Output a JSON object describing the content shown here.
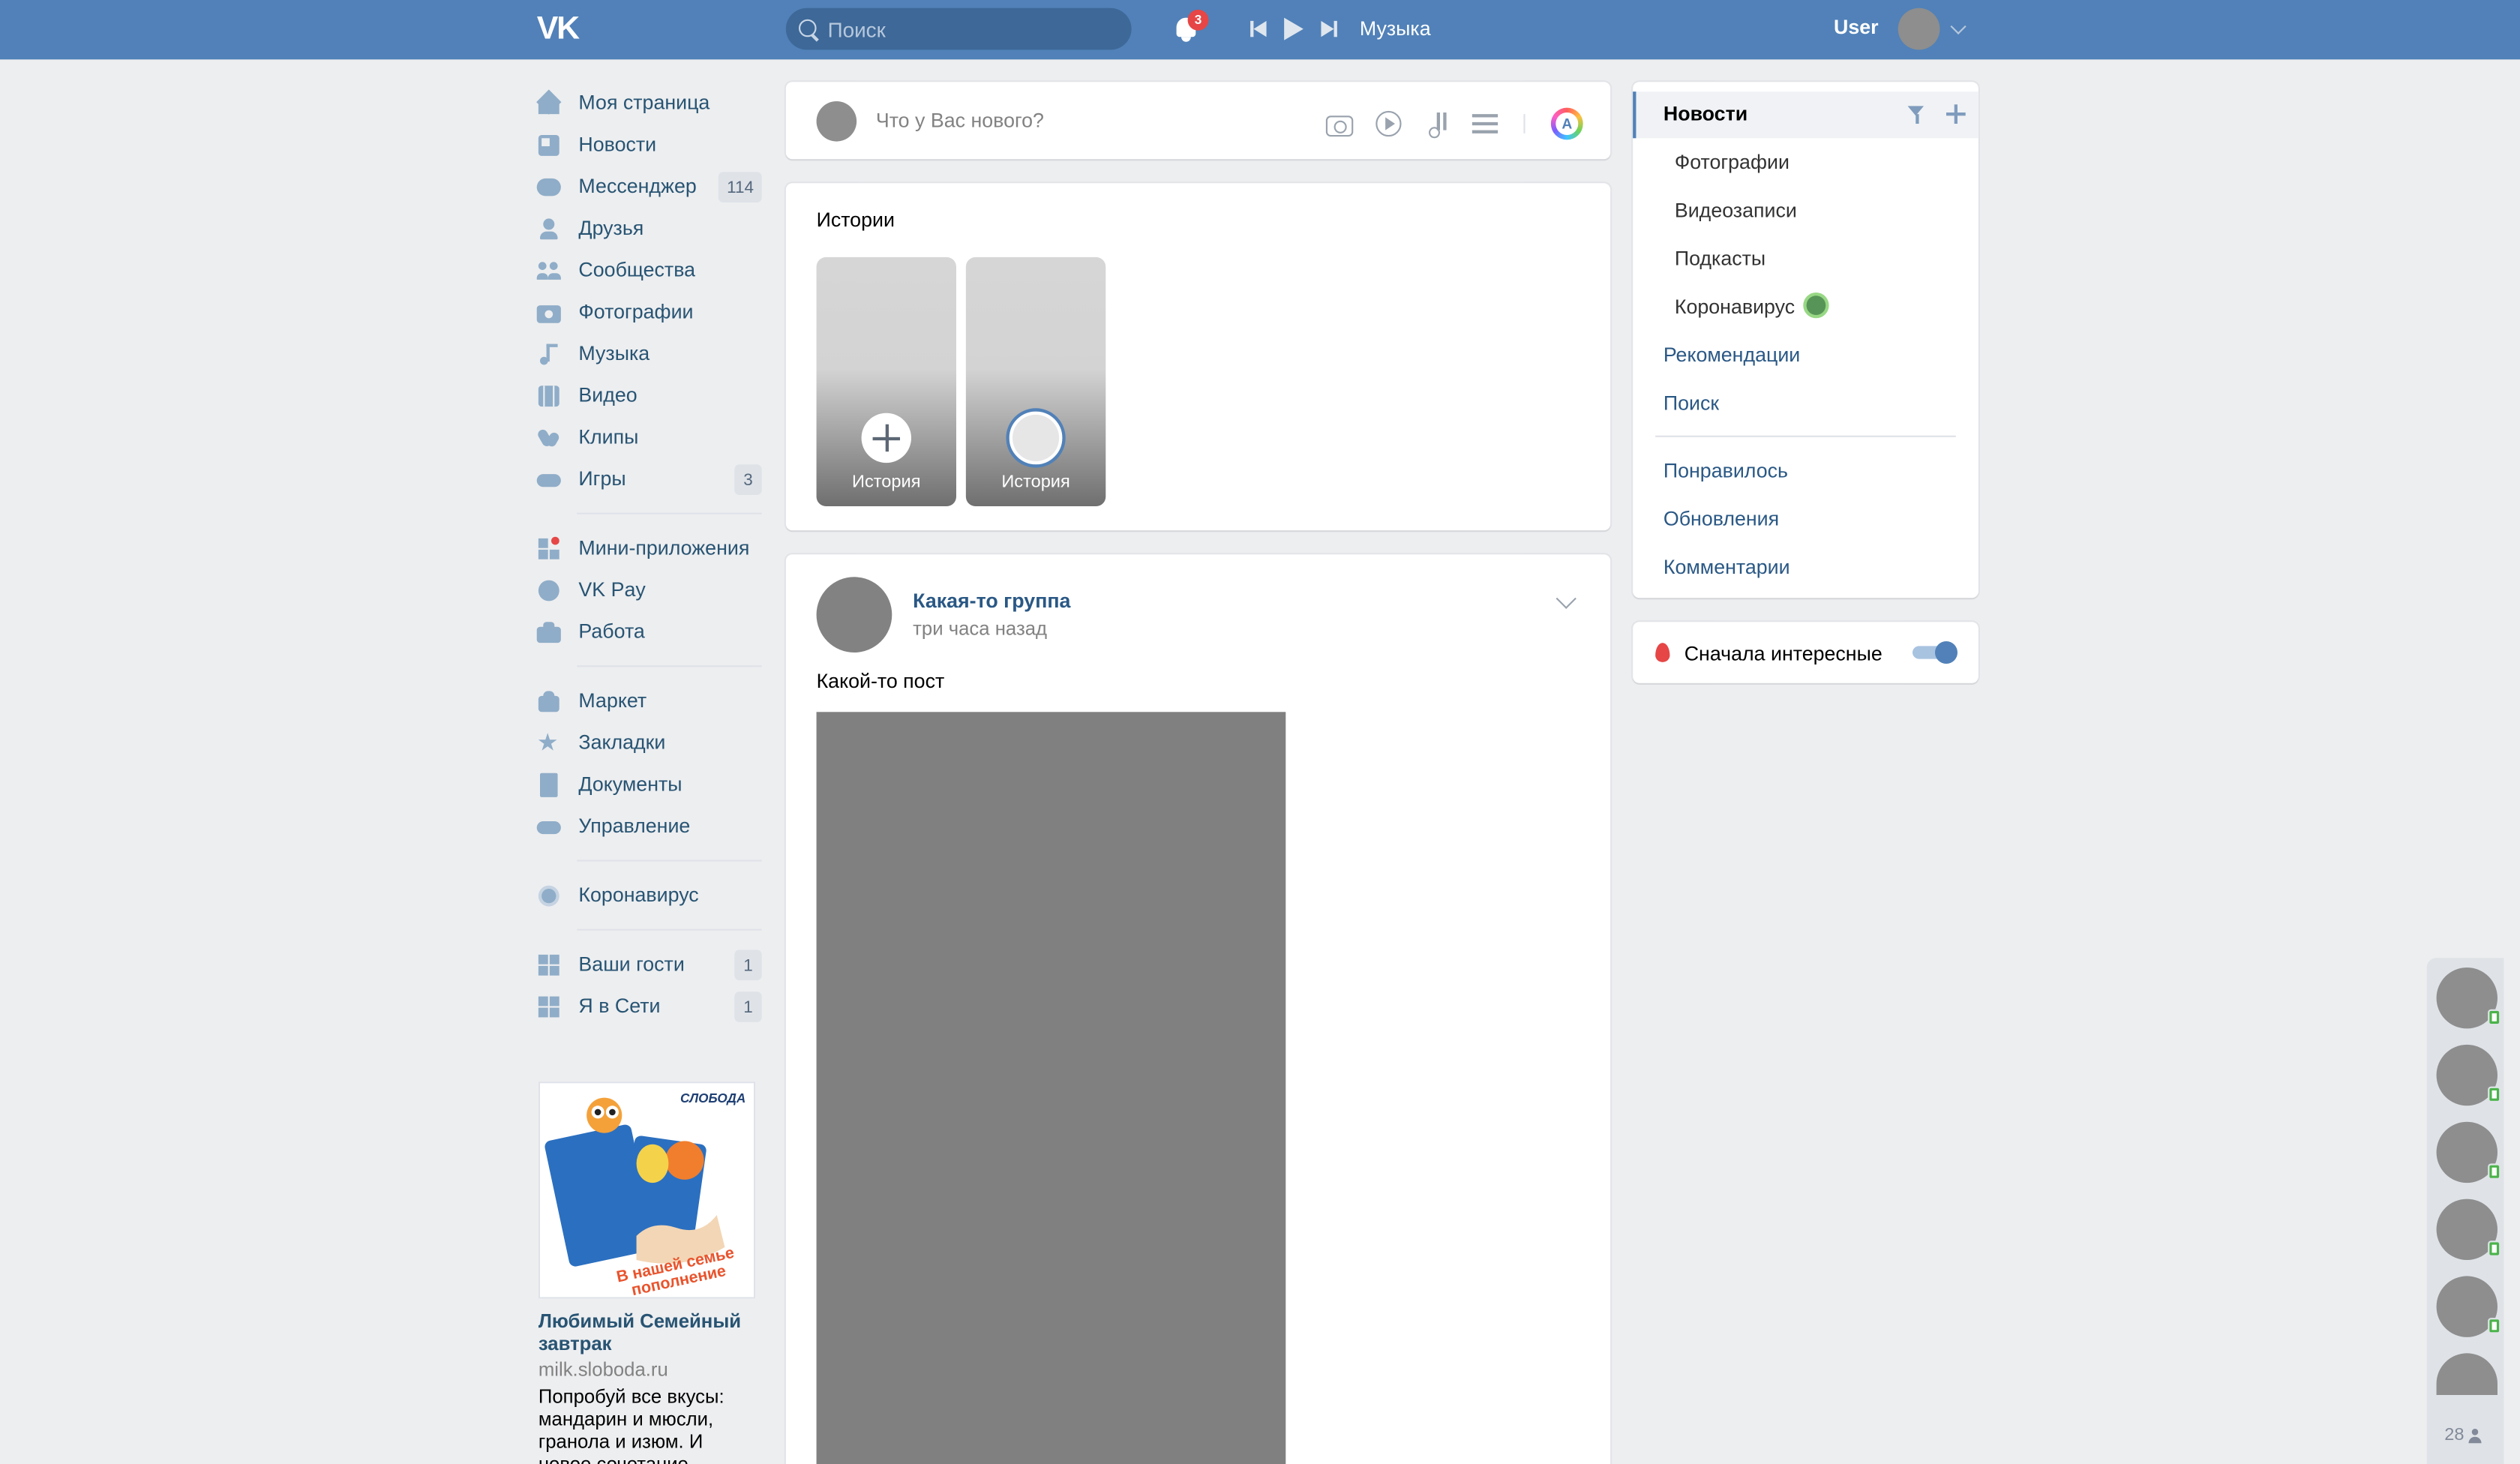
{
  "header": {
    "logo": "VK",
    "search_placeholder": "Поиск",
    "notifications_count": "3",
    "music_label": "Музыка",
    "user_name": "User"
  },
  "sidebar": {
    "items": [
      {
        "label": "Моя страница",
        "icon": "home-icon"
      },
      {
        "label": "Новости",
        "icon": "news-icon"
      },
      {
        "label": "Мессенджер",
        "icon": "messenger-icon",
        "count": "114"
      },
      {
        "label": "Друзья",
        "icon": "friends-icon"
      },
      {
        "label": "Сообщества",
        "icon": "communities-icon"
      },
      {
        "label": "Фотографии",
        "icon": "camera-icon"
      },
      {
        "label": "Музыка",
        "icon": "music-icon"
      },
      {
        "label": "Видео",
        "icon": "video-icon"
      },
      {
        "label": "Клипы",
        "icon": "clips-icon"
      },
      {
        "label": "Игры",
        "icon": "gamepad-icon",
        "count": "3"
      }
    ],
    "items2": [
      {
        "label": "Мини-приложения",
        "icon": "apps-icon"
      },
      {
        "label": "VK Pay",
        "icon": "vkpay-icon"
      },
      {
        "label": "Работа",
        "icon": "briefcase-icon"
      }
    ],
    "items3": [
      {
        "label": "Маркет",
        "icon": "market-icon"
      },
      {
        "label": "Закладки",
        "icon": "star-icon"
      },
      {
        "label": "Документы",
        "icon": "document-icon"
      },
      {
        "label": "Управление",
        "icon": "gamepad-icon"
      }
    ],
    "items4": [
      {
        "label": "Коронавирус",
        "icon": "virus-icon"
      }
    ],
    "items5": [
      {
        "label": "Ваши гости",
        "icon": "apps-icon",
        "count": "1"
      },
      {
        "label": "Я в Сети",
        "icon": "apps-icon",
        "count": "1"
      }
    ]
  },
  "ad": {
    "title": "Любимый Семейный завтрак",
    "domain": "milk.sloboda.ru",
    "text": "Попробуй все вкусы: мандарин и мюсли, гранола и изюм. И новое сочетание –",
    "brand": "СЛОБОДА",
    "slogan": "В нашей семье пополнение"
  },
  "composer": {
    "placeholder": "Что у Вас нового?"
  },
  "stories": {
    "title": "Истории",
    "items": [
      {
        "label": "История"
      },
      {
        "label": "История"
      }
    ]
  },
  "post": {
    "author": "Какая-то группа",
    "time": "три часа назад",
    "text": "Какой-то пост"
  },
  "right_nav": {
    "active": "Новости",
    "sub_items": [
      "Фотографии",
      "Видеозаписи",
      "Подкасты",
      "Коронавирус"
    ],
    "items": [
      "Рекомендации",
      "Поиск"
    ],
    "items2": [
      "Понравилось",
      "Обновления",
      "Комментарии"
    ]
  },
  "toggle": {
    "label": "Сначала интересные",
    "enabled": true
  },
  "friends_online": {
    "count": "28"
  },
  "colors": {
    "header": "#5181b8",
    "background": "#edeef0",
    "link": "#2a5885"
  }
}
